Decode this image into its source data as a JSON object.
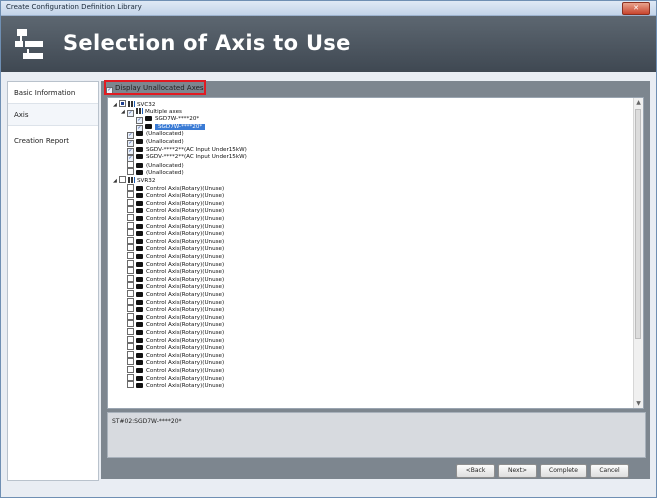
{
  "window": {
    "title": "Create Configuration Definition Library",
    "close_label": "✕"
  },
  "header": {
    "title": "Selection of Axis to Use"
  },
  "nav": {
    "items": [
      {
        "label": "Basic Information"
      },
      {
        "label": "Axis"
      },
      {
        "label": "Creation Report"
      }
    ]
  },
  "options": {
    "display_unallocated_label": "Display Unallocated Axes"
  },
  "tree": {
    "rows": [
      {
        "level": 0,
        "expander": "◢",
        "checkbox": "partial",
        "icon": "net",
        "text": "SVC32"
      },
      {
        "level": 1,
        "expander": "◢",
        "checkbox": "checked",
        "icon": "net",
        "text": "Multiple axes"
      },
      {
        "level": 2,
        "expander": "",
        "checkbox": "checked",
        "icon": "dev",
        "text": "SGD7W-****20*"
      },
      {
        "level": 2,
        "expander": "",
        "checkbox": "checked",
        "icon": "dev",
        "text": "SGD7W-****20*",
        "selected": true
      },
      {
        "level": 1,
        "expander": "",
        "checkbox": "checked",
        "icon": "dev",
        "text": "(Unallocated)"
      },
      {
        "level": 1,
        "expander": "",
        "checkbox": "checked",
        "icon": "dev",
        "text": "(Unallocated)"
      },
      {
        "level": 1,
        "expander": "",
        "checkbox": "checked",
        "icon": "dev",
        "text": "SGDV-****2**(AC Input Under15kW)"
      },
      {
        "level": 1,
        "expander": "",
        "checkbox": "checked",
        "icon": "dev",
        "text": "SGDV-****2**(AC Input Under15kW)"
      },
      {
        "level": 1,
        "expander": "",
        "checkbox": "unchecked",
        "icon": "dev",
        "text": "(Unallocated)"
      },
      {
        "level": 1,
        "expander": "",
        "checkbox": "unchecked",
        "icon": "dev",
        "text": "(Unallocated)"
      },
      {
        "level": 0,
        "expander": "◢",
        "checkbox": "unchecked",
        "icon": "net",
        "text": "SVR32"
      },
      {
        "level": 1,
        "expander": "",
        "checkbox": "unchecked",
        "icon": "dev",
        "text": "Control Axis(Rotary)(Unuse)"
      },
      {
        "level": 1,
        "expander": "",
        "checkbox": "unchecked",
        "icon": "dev",
        "text": "Control Axis(Rotary)(Unuse)"
      },
      {
        "level": 1,
        "expander": "",
        "checkbox": "unchecked",
        "icon": "dev",
        "text": "Control Axis(Rotary)(Unuse)"
      },
      {
        "level": 1,
        "expander": "",
        "checkbox": "unchecked",
        "icon": "dev",
        "text": "Control Axis(Rotary)(Unuse)"
      },
      {
        "level": 1,
        "expander": "",
        "checkbox": "unchecked",
        "icon": "dev",
        "text": "Control Axis(Rotary)(Unuse)"
      },
      {
        "level": 1,
        "expander": "",
        "checkbox": "unchecked",
        "icon": "dev",
        "text": "Control Axis(Rotary)(Unuse)"
      },
      {
        "level": 1,
        "expander": "",
        "checkbox": "unchecked",
        "icon": "dev",
        "text": "Control Axis(Rotary)(Unuse)"
      },
      {
        "level": 1,
        "expander": "",
        "checkbox": "unchecked",
        "icon": "dev",
        "text": "Control Axis(Rotary)(Unuse)"
      },
      {
        "level": 1,
        "expander": "",
        "checkbox": "unchecked",
        "icon": "dev",
        "text": "Control Axis(Rotary)(Unuse)"
      },
      {
        "level": 1,
        "expander": "",
        "checkbox": "unchecked",
        "icon": "dev",
        "text": "Control Axis(Rotary)(Unuse)"
      },
      {
        "level": 1,
        "expander": "",
        "checkbox": "unchecked",
        "icon": "dev",
        "text": "Control Axis(Rotary)(Unuse)"
      },
      {
        "level": 1,
        "expander": "",
        "checkbox": "unchecked",
        "icon": "dev",
        "text": "Control Axis(Rotary)(Unuse)"
      },
      {
        "level": 1,
        "expander": "",
        "checkbox": "unchecked",
        "icon": "dev",
        "text": "Control Axis(Rotary)(Unuse)"
      },
      {
        "level": 1,
        "expander": "",
        "checkbox": "unchecked",
        "icon": "dev",
        "text": "Control Axis(Rotary)(Unuse)"
      },
      {
        "level": 1,
        "expander": "",
        "checkbox": "unchecked",
        "icon": "dev",
        "text": "Control Axis(Rotary)(Unuse)"
      },
      {
        "level": 1,
        "expander": "",
        "checkbox": "unchecked",
        "icon": "dev",
        "text": "Control Axis(Rotary)(Unuse)"
      },
      {
        "level": 1,
        "expander": "",
        "checkbox": "unchecked",
        "icon": "dev",
        "text": "Control Axis(Rotary)(Unuse)"
      },
      {
        "level": 1,
        "expander": "",
        "checkbox": "unchecked",
        "icon": "dev",
        "text": "Control Axis(Rotary)(Unuse)"
      },
      {
        "level": 1,
        "expander": "",
        "checkbox": "unchecked",
        "icon": "dev",
        "text": "Control Axis(Rotary)(Unuse)"
      },
      {
        "level": 1,
        "expander": "",
        "checkbox": "unchecked",
        "icon": "dev",
        "text": "Control Axis(Rotary)(Unuse)"
      },
      {
        "level": 1,
        "expander": "",
        "checkbox": "unchecked",
        "icon": "dev",
        "text": "Control Axis(Rotary)(Unuse)"
      },
      {
        "level": 1,
        "expander": "",
        "checkbox": "unchecked",
        "icon": "dev",
        "text": "Control Axis(Rotary)(Unuse)"
      },
      {
        "level": 1,
        "expander": "",
        "checkbox": "unchecked",
        "icon": "dev",
        "text": "Control Axis(Rotary)(Unuse)"
      },
      {
        "level": 1,
        "expander": "",
        "checkbox": "unchecked",
        "icon": "dev",
        "text": "Control Axis(Rotary)(Unuse)"
      },
      {
        "level": 1,
        "expander": "",
        "checkbox": "unchecked",
        "icon": "dev",
        "text": "Control Axis(Rotary)(Unuse)"
      },
      {
        "level": 1,
        "expander": "",
        "checkbox": "unchecked",
        "icon": "dev",
        "text": "Control Axis(Rotary)(Unuse)"
      },
      {
        "level": 1,
        "expander": "",
        "checkbox": "unchecked",
        "icon": "dev",
        "text": "Control Axis(Rotary)(Unuse)"
      }
    ]
  },
  "description": {
    "text": "ST#02:SGD7W-****20*"
  },
  "buttons": {
    "back": "<Back",
    "next": "Next>",
    "complete": "Complete",
    "cancel": "Cancel"
  }
}
